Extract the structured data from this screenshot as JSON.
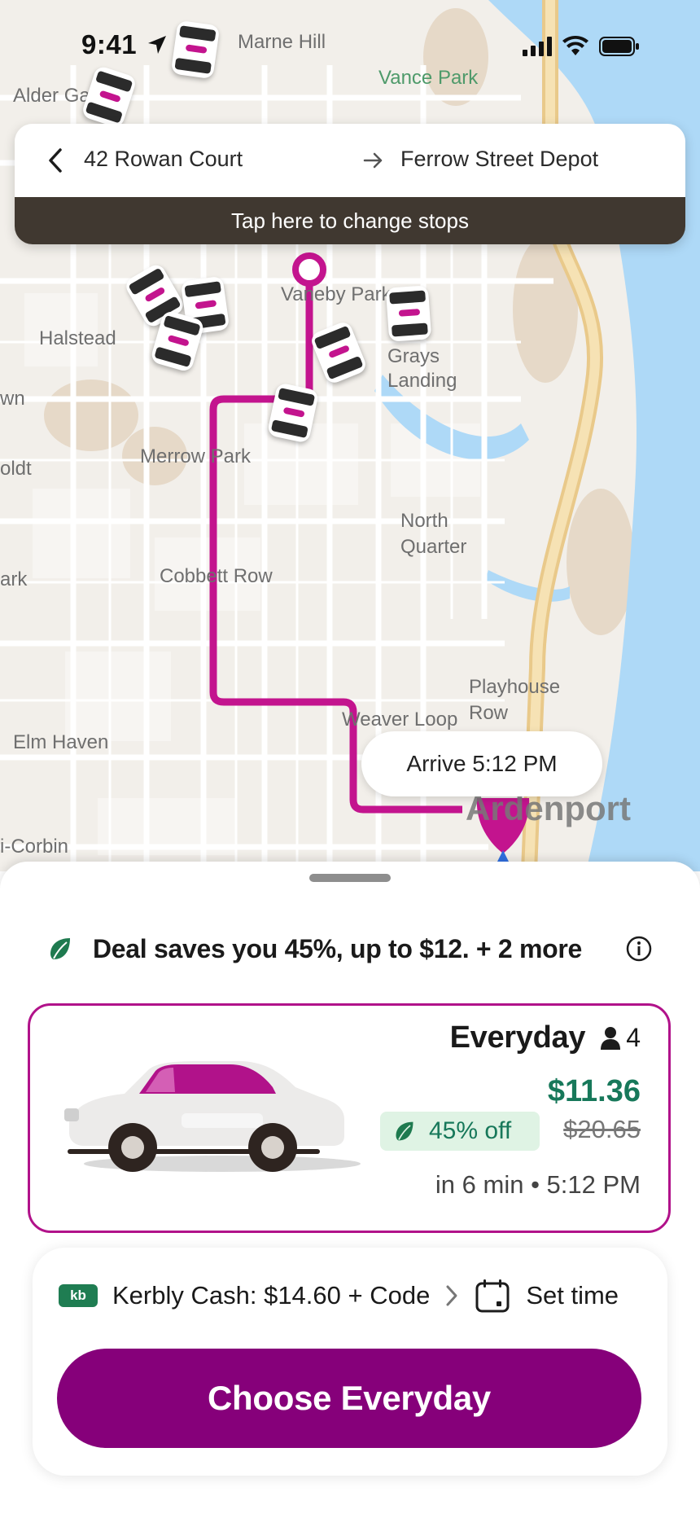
{
  "status_bar": {
    "time": "9:41"
  },
  "map": {
    "labels": {
      "marne_hill": "Marne Hill",
      "vance_park": "Vance Park",
      "alder_gate": "Alder Gate",
      "vaneby_park": "Vaneby Park",
      "halstead": "Halstead",
      "grays_landing_1": "Grays",
      "grays_landing_2": "Landing",
      "town_partial": "wn",
      "merrow_park": "Merrow Park",
      "boldt_partial": "oldt",
      "north_quarter_1": "North",
      "north_quarter_2": "Quarter",
      "park_partial": "ark",
      "cobbett_row": "Cobbett Row",
      "playhouse_row_1": "Playhouse",
      "playhouse_row_2": "Row",
      "weaver_loop": "Weaver Loop",
      "elm_haven": "Elm Haven",
      "ardenport": "Ardenport",
      "corbin_partial": "i-Corbin"
    },
    "arrive_label": "Arrive 5:12 PM",
    "colors": {
      "route": "#c3148e",
      "water": "#aed9f7",
      "land": "#f2efea",
      "park_patch": "#e6d9c8",
      "road": "#ffffff",
      "highway": "#f3d9a2"
    }
  },
  "route_card": {
    "origin": "42 Rowan Court",
    "destination": "Ferrow Street Depot",
    "change_stops": "Tap here to change stops"
  },
  "sheet": {
    "deal_text": "Deal saves you 45%, up to $12. + 2 more",
    "option": {
      "name": "Everyday",
      "seats": "4",
      "price": "$11.36",
      "discount": "45% off",
      "original_price": "$20.65",
      "eta": "in 6 min • 5:12 PM"
    },
    "payment": {
      "badge": "kb",
      "cash_label": "Kerbly Cash: $14.60 + Code",
      "set_time_label": "Set time"
    },
    "cta_label": "Choose Everyday"
  },
  "icons": [
    "location-arrow-icon",
    "cellular-signal-icon",
    "wifi-icon",
    "battery-icon",
    "back-chevron-icon",
    "arrow-right-icon",
    "leaf-icon",
    "info-icon",
    "person-icon",
    "chevron-right-icon",
    "calendar-icon",
    "taxi-icon",
    "car-icon",
    "destination-pin-icon"
  ],
  "brand_colors": {
    "accent": "#86007a",
    "accent_border": "#b1128a",
    "discount_green": "#17785a",
    "badge_green_bg": "#dff3e4",
    "banner_dark": "#403830"
  }
}
